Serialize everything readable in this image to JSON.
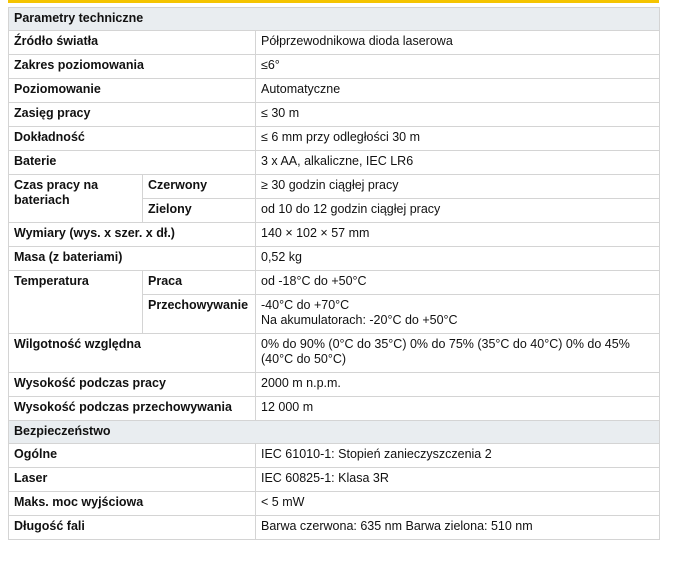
{
  "sections": {
    "tech_title": "Parametry techniczne",
    "safety_title": "Bezpieczeństwo"
  },
  "tech": [
    {
      "label": "Źródło światła",
      "value": "Półprzewodnikowa dioda laserowa"
    },
    {
      "label": "Zakres poziomowania",
      "value": "≤6°"
    },
    {
      "label": "Poziomowanie",
      "value": "Automatyczne"
    },
    {
      "label": "Zasięg pracy",
      "value": "≤ 30 m"
    },
    {
      "label": "Dokładność",
      "value": "≤ 6 mm przy odległości 30 m"
    },
    {
      "label": "Baterie",
      "value": "3 x AA, alkaliczne, IEC LR6"
    }
  ],
  "battery_time": {
    "label": "Czas pracy na bateriach",
    "rows": [
      {
        "sub": "Czerwony",
        "value": "≥ 30 godzin ciągłej pracy"
      },
      {
        "sub": "Zielony",
        "value": "od 10 do 12 godzin ciągłej pracy"
      }
    ]
  },
  "tech2": [
    {
      "label": "Wymiary (wys. x szer. x dł.)",
      "value": "140 × 102 × 57 mm"
    },
    {
      "label": "Masa (z bateriami)",
      "value": "0,52 kg"
    }
  ],
  "temperature": {
    "label": "Temperatura",
    "rows": [
      {
        "sub": "Praca",
        "value": "od -18°C do +50°C"
      },
      {
        "sub": "Przechowywanie",
        "value_line1": "-40°C do +70°C",
        "value_line2": "Na akumulatorach: -20°C do +50°C"
      }
    ]
  },
  "humidity": {
    "label": "Wilgotność względna",
    "value": "0% do 90% (0°C do 35°C) 0% do 75% (35°C do 40°C) 0% do 45% (40°C do 50°C)"
  },
  "tech3": [
    {
      "label": "Wysokość podczas pracy",
      "value": "2000 m n.p.m."
    },
    {
      "label": "Wysokość podczas przechowywania",
      "value": "12 000 m"
    }
  ],
  "safety": [
    {
      "label": "Ogólne",
      "value": "IEC 61010-1: Stopień zanieczyszczenia 2"
    },
    {
      "label": "Laser",
      "value": "IEC 60825-1: Klasa 3R"
    },
    {
      "label": "Maks. moc wyjściowa",
      "value": "< 5 mW"
    },
    {
      "label": "Długość fali",
      "value": "Barwa czerwona: 635 nm Barwa zielona: 510 nm"
    }
  ],
  "colors": {
    "accent_bar": "#f5c400",
    "section_bg": "#e9edf0",
    "border": "#d4d4d4"
  }
}
